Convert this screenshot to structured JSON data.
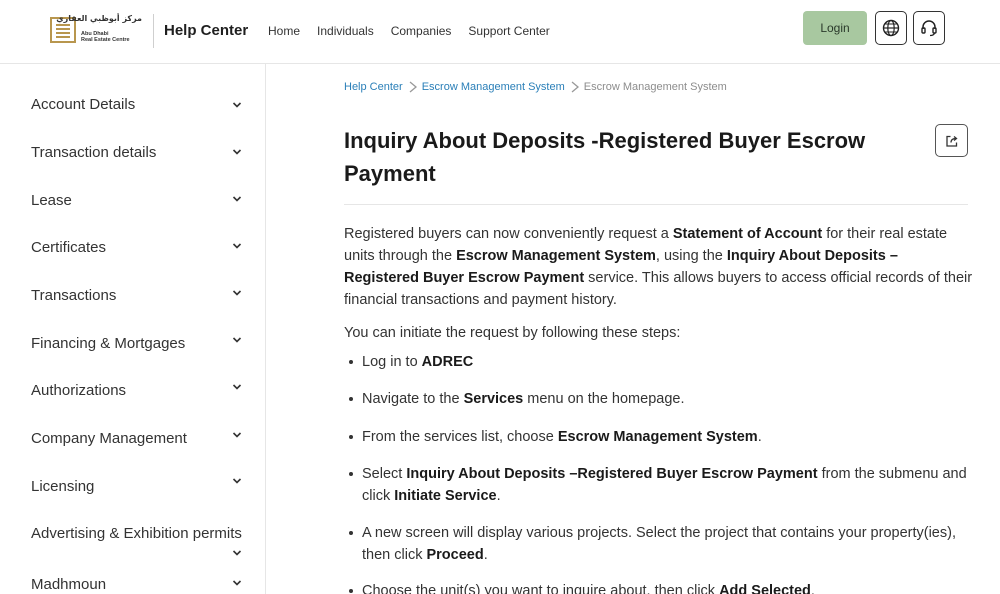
{
  "header": {
    "logo_ar": "مركز أبوظبي العقاري",
    "logo_en": "Abu Dhabi\nReal Estate Centre",
    "brand": "Help Center",
    "nav": [
      "Home",
      "Individuals",
      "Companies",
      "Support Center"
    ],
    "login_label": "Login",
    "icons": [
      "globe-icon",
      "headset-icon"
    ]
  },
  "sidebar": {
    "items": [
      {
        "label": "Account Details"
      },
      {
        "label": "Transaction details"
      },
      {
        "label": "Lease"
      },
      {
        "label": "Certificates"
      },
      {
        "label": "Transactions"
      },
      {
        "label": "Financing & Mortgages"
      },
      {
        "label": "Authorizations"
      },
      {
        "label": "Company Management"
      },
      {
        "label": "Licensing"
      },
      {
        "label": "Advertising & Exhibition permits"
      },
      {
        "label": "Madhmoun"
      }
    ]
  },
  "breadcrumb": {
    "items": [
      "Help Center",
      "Escrow Management System",
      "Escrow Management System"
    ]
  },
  "article": {
    "title": "Inquiry About Deposits -Registered Buyer Escrow Payment",
    "intro": {
      "p1": "Registered buyers can now conveniently request a ",
      "b1": "Statement of Account",
      "p2": " for their real estate units through the ",
      "b2": "Escrow Management System",
      "p3": ", using the ",
      "b3": "Inquiry About Deposits – Registered Buyer Escrow Payment",
      "p4": " service. This allows buyers to access official records of their financial transactions and payment history."
    },
    "lead": "You can initiate the request by following these steps:",
    "steps": [
      {
        "t1": "Log in to ",
        "b1": "ADREC",
        "t2": "",
        "b2": "",
        "t3": ""
      },
      {
        "t1": "Navigate to the ",
        "b1": "Services",
        "t2": " menu on the homepage.",
        "b2": "",
        "t3": ""
      },
      {
        "t1": "From the services list, choose ",
        "b1": "Escrow Management System",
        "t2": ".",
        "b2": "",
        "t3": ""
      },
      {
        "t1": "Select ",
        "b1": "Inquiry About Deposits –Registered Buyer Escrow Payment",
        "t2": " from the submenu and click ",
        "b2": "Initiate Service",
        "t3": "."
      },
      {
        "t1": "A new screen will display various projects. Select the project that contains your property(ies), then click ",
        "b1": "Proceed",
        "t2": ".",
        "b2": "",
        "t3": ""
      },
      {
        "t1": "Choose the unit(s) you want to inquire about, then click ",
        "b1": "Add Selected",
        "t2": ".",
        "b2": "",
        "t3": ""
      }
    ]
  },
  "colors": {
    "login_bg": "#a8c8a0",
    "link": "#2a7fb8",
    "logo_gold": "#b8964e"
  }
}
